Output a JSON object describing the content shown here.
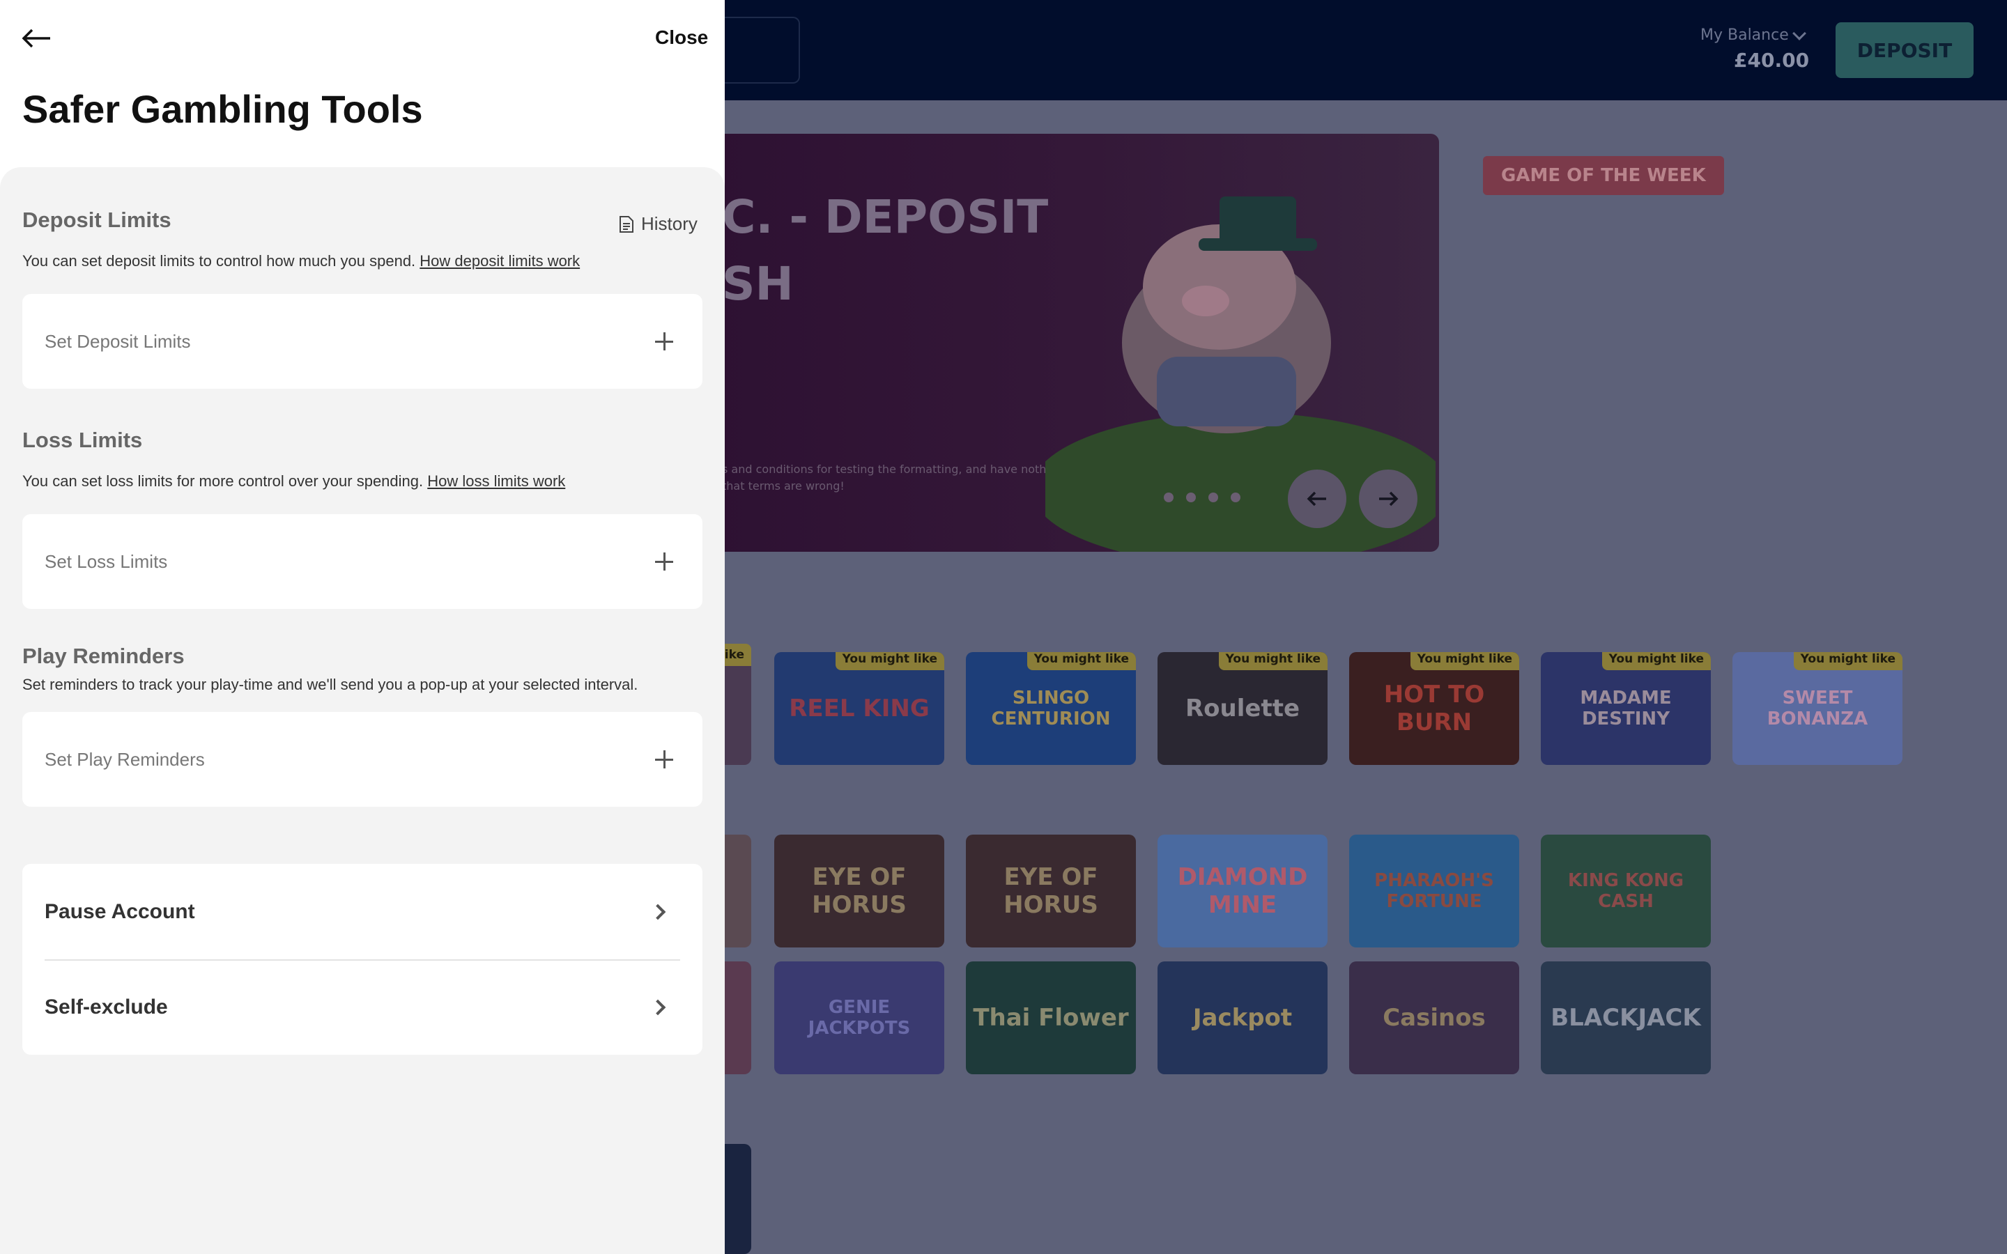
{
  "background": {
    "header": {
      "balance_label": "My Balance",
      "balance_value": "£40.00",
      "deposit_label": "DEPOSIT"
    },
    "hero": {
      "title": "C. - DEPOSIT\nSH",
      "terms": "s and conditions for testing the formatting, and have nothing to do ct that terms are wrong!",
      "slide_count": 4
    },
    "game_of_week_label": "GAME OF THE WEEK",
    "badge_label": "You might like",
    "games_row1": [
      {
        "name": "REEL KING",
        "bg": "#223a70",
        "fg": "#8a3a4a"
      },
      {
        "name": "SLINGO CENTURION",
        "bg": "#1d3e79",
        "fg": "#a08c55"
      },
      {
        "name": "Roulette",
        "bg": "#2a2732",
        "fg": "#8a8890"
      },
      {
        "name": "HOT TO BURN",
        "bg": "#3a1f20",
        "fg": "#9a3a34"
      },
      {
        "name": "MADAME DESTINY",
        "bg": "#2c3468",
        "fg": "#9a8c9a"
      },
      {
        "name": "SWEET BONANZA",
        "bg": "#5a6aa0",
        "fg": "#b48aa8"
      }
    ],
    "games_row2": [
      {
        "name": "EYE OF HORUS",
        "bg": "#3a2a30",
        "fg": "#8a7a60"
      },
      {
        "name": "EYE OF HORUS",
        "bg": "#3a2a30",
        "fg": "#8a7a60"
      },
      {
        "name": "DIAMOND MINE",
        "bg": "#4a6aa0",
        "fg": "#b05a6a"
      },
      {
        "name": "PHARAOH'S FORTUNE",
        "bg": "#2a5a8a",
        "fg": "#8a4a40"
      },
      {
        "name": "KING KONG CASH",
        "bg": "#2a4a40",
        "fg": "#8a4a4a"
      }
    ],
    "games_row3": [
      {
        "name": "GENIE JACKPOTS",
        "bg": "#3a3a70",
        "fg": "#6a6aa8"
      },
      {
        "name": "Thai Flower",
        "bg": "#1e3a3a",
        "fg": "#8a8a70"
      },
      {
        "name": "Jackpot",
        "bg": "#24345a",
        "fg": "#9a8a60"
      },
      {
        "name": "Casinos",
        "bg": "#3a2e4a",
        "fg": "#8a7a60"
      },
      {
        "name": "BLACKJACK",
        "bg": "#2a3a50",
        "fg": "#8a90a0"
      }
    ]
  },
  "drawer": {
    "close_label": "Close",
    "title": "Safer Gambling Tools",
    "history_label": "History",
    "deposit": {
      "title": "Deposit Limits",
      "desc": "You can set deposit limits to control how much you spend.",
      "link": "How deposit limits work",
      "button": "Set Deposit Limits"
    },
    "loss": {
      "title": "Loss Limits",
      "desc": "You can set loss limits for more control over your spending.",
      "link": "How loss limits work",
      "button": "Set Loss Limits"
    },
    "reminders": {
      "title": "Play Reminders",
      "desc": "Set reminders to track your play-time and we'll send you a pop-up at your selected interval.",
      "button": "Set Play Reminders"
    },
    "actions": {
      "pause": "Pause Account",
      "exclude": "Self-exclude"
    }
  },
  "colors": {
    "overlay_bg": "#5d6179",
    "header_bg": "#010d2c",
    "deposit_button": "#2a5b5e",
    "drawer_bg": "#ffffff",
    "panel_bg": "#f3f3f3"
  }
}
